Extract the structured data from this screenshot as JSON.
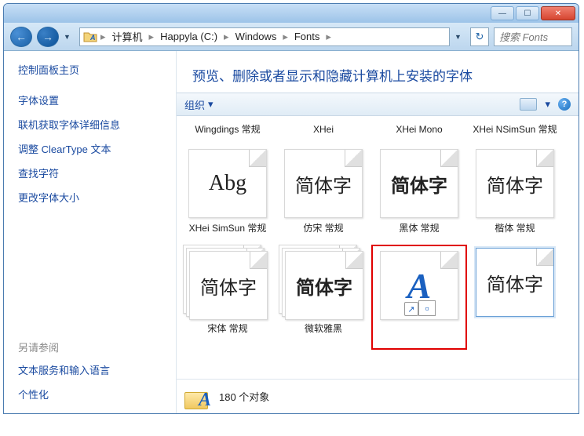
{
  "titlebar": {
    "min": "—",
    "max": "☐",
    "close": "✕"
  },
  "breadcrumb": {
    "items": [
      "计算机",
      "Happyla (C:)",
      "Windows",
      "Fonts"
    ],
    "sep": "▸"
  },
  "search": {
    "placeholder": "搜索 Fonts"
  },
  "refresh": {
    "icon": "↻"
  },
  "nav": {
    "back": "←",
    "fwd": "→",
    "drop": "▼"
  },
  "sidebar": {
    "title": "控制面板主页",
    "links": [
      "字体设置",
      "联机获取字体详细信息",
      "调整 ClearType 文本",
      "查找字符",
      "更改字体大小"
    ],
    "section": "另请参阅",
    "more": [
      "文本服务和输入语言",
      "个性化"
    ]
  },
  "content": {
    "heading": "预览、删除或者显示和隐藏计算机上安装的字体",
    "toolbar": {
      "organize": "组织",
      "drop": "▾",
      "view_drop": "▾",
      "help": "?"
    }
  },
  "fonts": {
    "row1_labels": [
      "Wingdings 常规",
      "XHei",
      "XHei Mono",
      "XHei NSimSun 常规"
    ],
    "row2": [
      {
        "label": "XHei SimSun 常规",
        "sample": "Abg",
        "latin": true
      },
      {
        "label": "仿宋 常规",
        "sample": "简体字"
      },
      {
        "label": "黑体 常规",
        "sample": "简体字"
      },
      {
        "label": "楷体 常规",
        "sample": "简体字"
      }
    ],
    "row3": [
      {
        "label": "宋体 常规",
        "sample": "简体字",
        "stack": true
      },
      {
        "label": "微软雅黑",
        "sample": "简体字",
        "stack": true
      },
      {
        "label": "",
        "aicon": true,
        "shortcut": true,
        "highlight": true
      },
      {
        "label": "",
        "sample": "简体字",
        "last": true
      }
    ]
  },
  "status": {
    "count": "180 个对象",
    "A": "A"
  }
}
